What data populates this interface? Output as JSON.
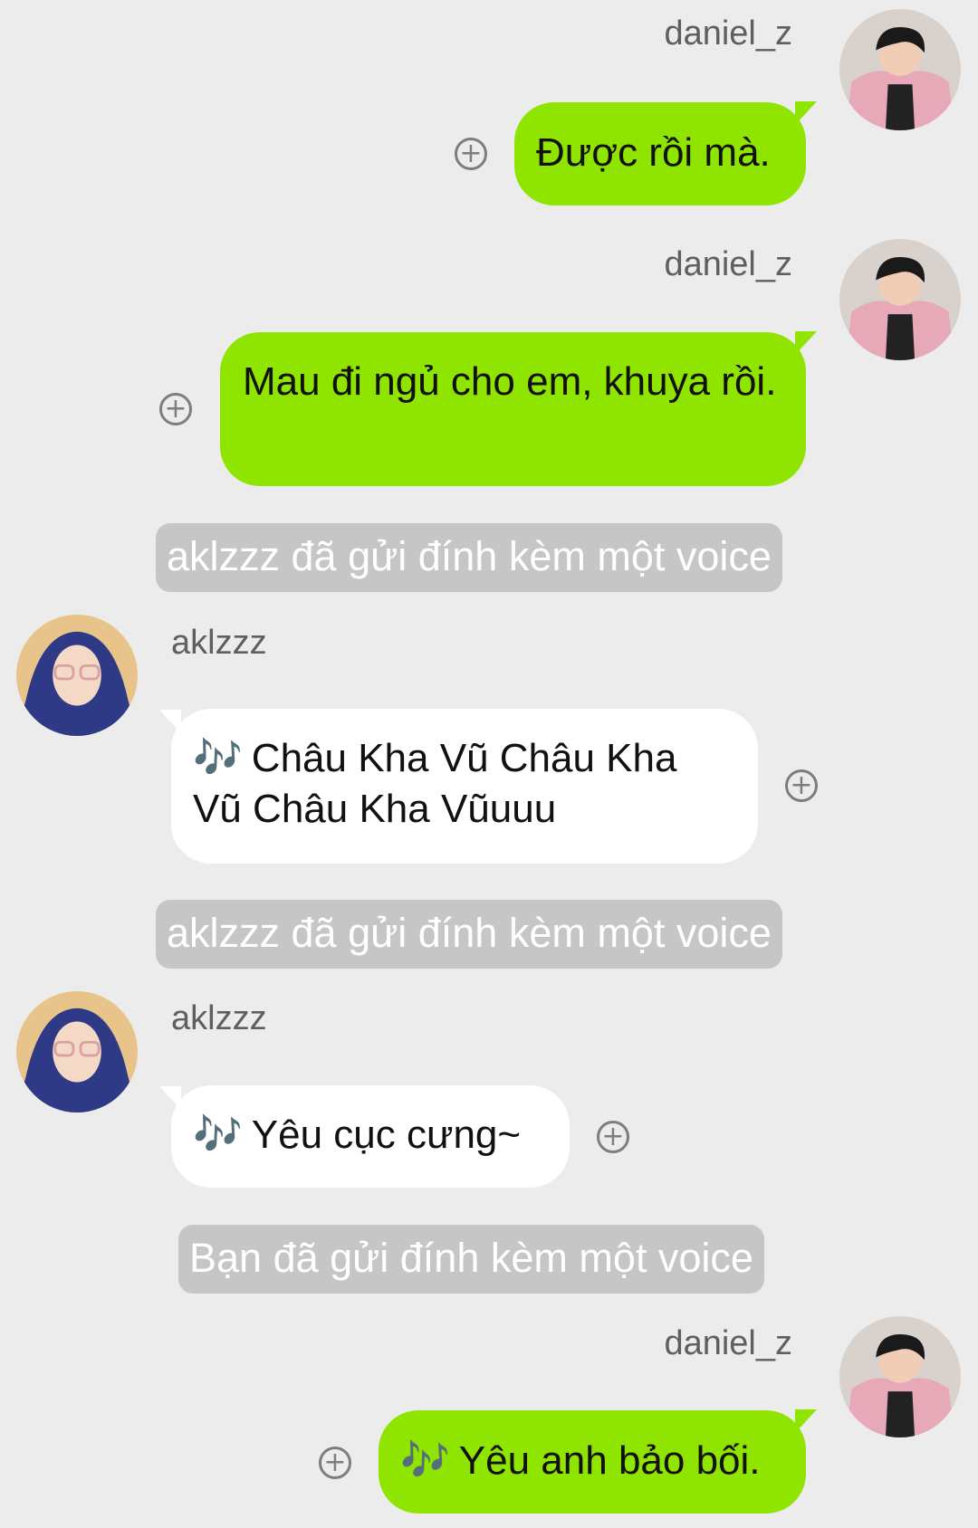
{
  "messages": [
    {
      "sender": "daniel_z",
      "text": "Được rồi mà."
    },
    {
      "sender": "daniel_z",
      "text": "Mau đi ngủ cho em, khuya rồi."
    },
    {
      "system": "aklzzz đã gửi đính kèm một voice"
    },
    {
      "sender": "aklzzz",
      "voice_icon": "music-note-icon",
      "text": "Châu Kha Vũ Châu Kha Vũ Châu Kha Vũuuu"
    },
    {
      "system": "aklzzz đã gửi đính kèm một voice"
    },
    {
      "sender": "aklzzz",
      "voice_icon": "music-note-icon",
      "text": "Yêu cục cưng~"
    },
    {
      "system": "Bạn đã gửi đính kèm một voice"
    },
    {
      "sender": "daniel_z",
      "voice_icon": "music-note-icon",
      "text": "Yêu anh bảo bối."
    }
  ],
  "icons": {
    "plus": "+",
    "note": "🎶"
  },
  "colors": {
    "background": "#ececec",
    "sent_bubble": "#8fe400",
    "received_bubble": "#ffffff",
    "system_pill": "#c6c6c6"
  }
}
